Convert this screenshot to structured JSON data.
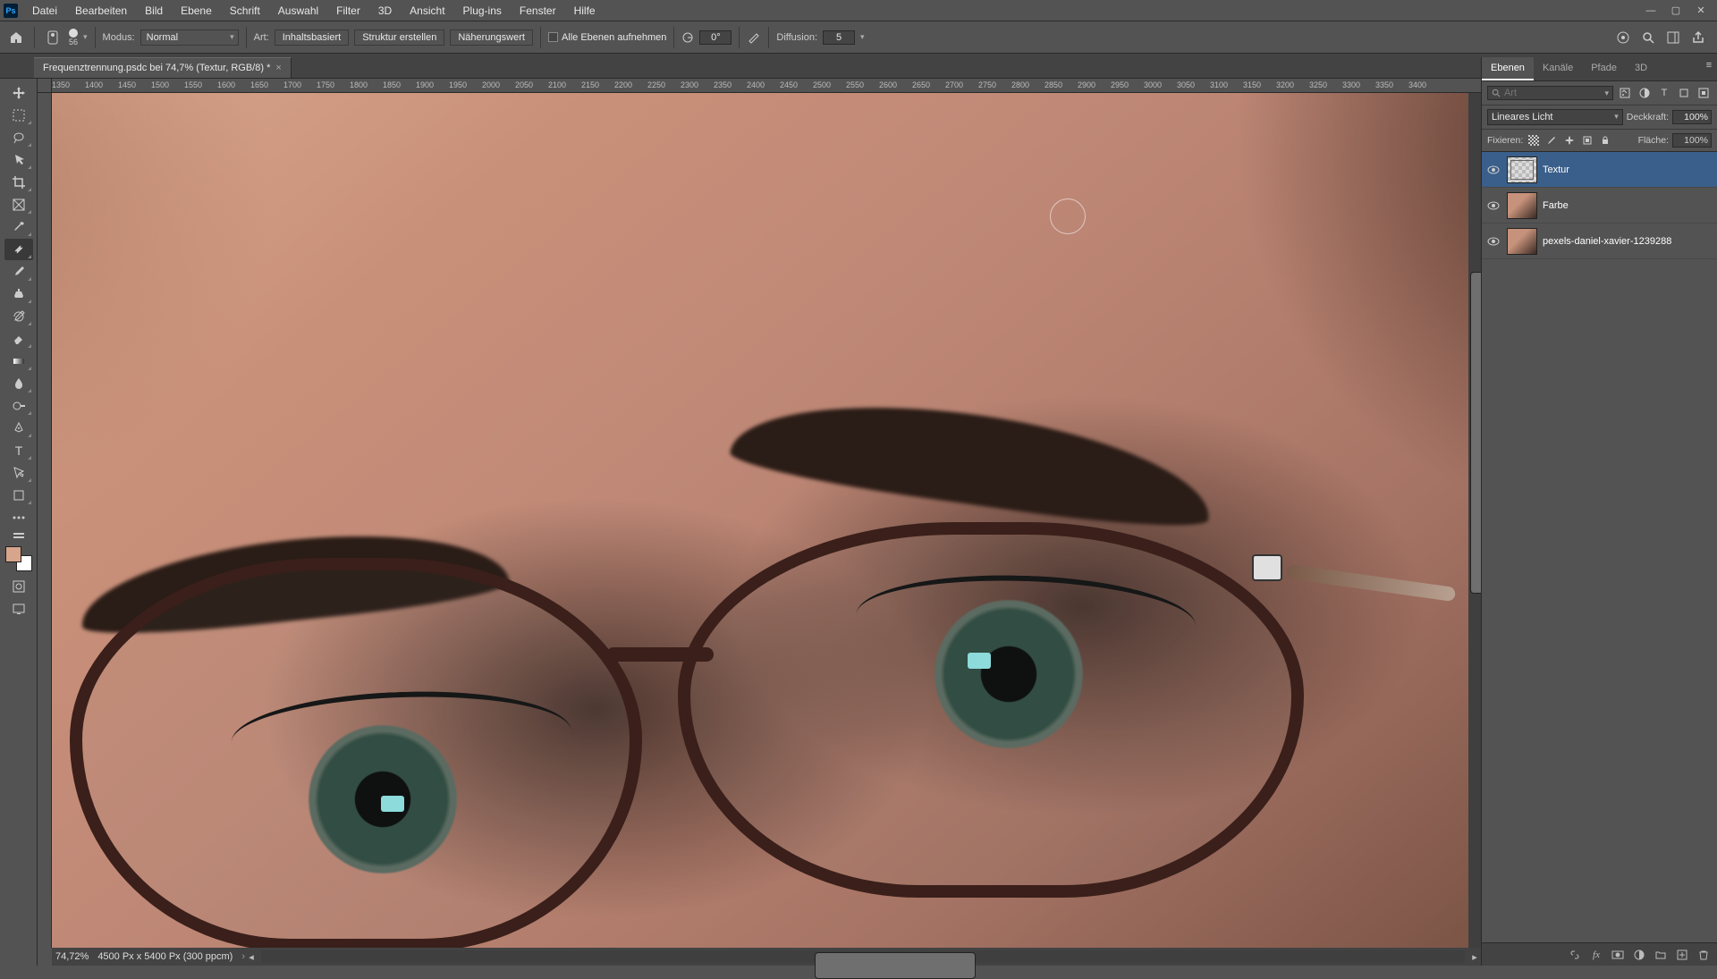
{
  "menu": {
    "items": [
      "Datei",
      "Bearbeiten",
      "Bild",
      "Ebene",
      "Schrift",
      "Auswahl",
      "Filter",
      "3D",
      "Ansicht",
      "Plug-ins",
      "Fenster",
      "Hilfe"
    ]
  },
  "options": {
    "brush_size": "56",
    "mode_label": "Modus:",
    "mode_value": "Normal",
    "type_label": "Art:",
    "btn_content_aware": "Inhaltsbasiert",
    "btn_create_texture": "Struktur erstellen",
    "btn_proximity": "Näherungswert",
    "sample_all": "Alle Ebenen aufnehmen",
    "angle": "0°",
    "diffusion_label": "Diffusion:",
    "diffusion_value": "5"
  },
  "document": {
    "tab_title": "Frequenztrennung.psdc bei 74,7% (Textur, RGB/8) *"
  },
  "ruler": {
    "ticks": [
      "1350",
      "1400",
      "1450",
      "1500",
      "1550",
      "1600",
      "1650",
      "1700",
      "1750",
      "1800",
      "1850",
      "1900",
      "1950",
      "2000",
      "2050",
      "2100",
      "2150",
      "2200",
      "2250",
      "2300",
      "2350",
      "2400",
      "2450",
      "2500",
      "2550",
      "2600",
      "2650",
      "2700",
      "2750",
      "2800",
      "2850",
      "2900",
      "2950",
      "3000",
      "3050",
      "3100",
      "3150",
      "3200",
      "3250",
      "3300",
      "3350",
      "3400"
    ]
  },
  "status": {
    "zoom": "74,72%",
    "doc_info": "4500 Px x 5400 Px (300 ppcm)"
  },
  "panels": {
    "tabs": [
      "Ebenen",
      "Kanäle",
      "Pfade",
      "3D"
    ],
    "search_placeholder": "Art",
    "blend_mode": "Lineares Licht",
    "opacity_label": "Deckkraft:",
    "opacity_value": "100%",
    "lock_label": "Fixieren:",
    "fill_label": "Fläche:",
    "fill_value": "100%",
    "layers": [
      {
        "name": "Textur",
        "selected": true,
        "thumb": "tex"
      },
      {
        "name": "Farbe",
        "selected": false,
        "thumb": "ph"
      },
      {
        "name": "pexels-daniel-xavier-1239288",
        "selected": false,
        "thumb": "ph"
      }
    ]
  },
  "colors": {
    "panel_bg": "#535353",
    "accent": "#3a5f8a"
  }
}
